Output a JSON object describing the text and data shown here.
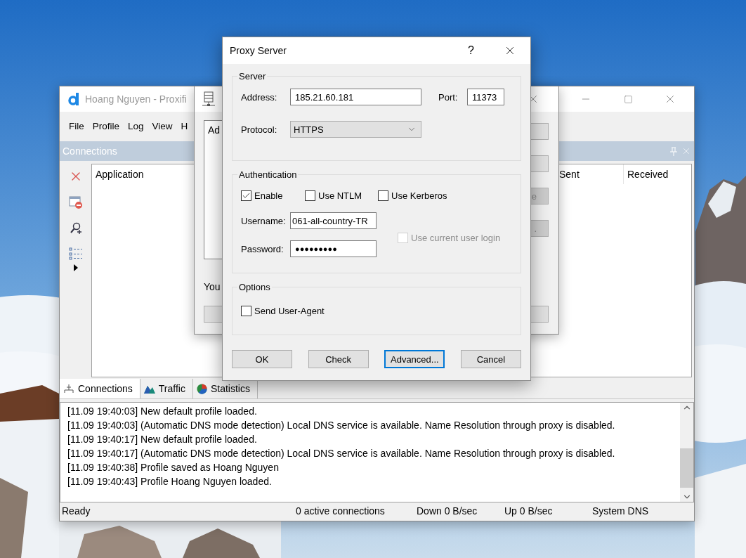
{
  "main_window": {
    "title": "Hoang Nguyen - Proxifi",
    "menu": [
      "File",
      "Profile",
      "Log",
      "View",
      "H"
    ],
    "panel": {
      "title": "Connections"
    },
    "table": {
      "columns": [
        "Application",
        "Sent",
        "Received"
      ]
    },
    "tabs": [
      {
        "label": "Connections",
        "selected": true
      },
      {
        "label": "Traffic",
        "selected": false
      },
      {
        "label": "Statistics",
        "selected": false
      }
    ],
    "log": [
      "[11.09 19:40:03] New default profile loaded.",
      "[11.09 19:40:03] (Automatic DNS mode detection) Local DNS service is available. Name Resolution through proxy is disabled.",
      "[11.09 19:40:17] New default profile loaded.",
      "[11.09 19:40:17] (Automatic DNS mode detection) Local DNS service is available. Name Resolution through proxy is disabled.",
      "[11.09 19:40:38] Profile saved as Hoang Nguyen",
      "[11.09 19:40:43] Profile Hoang Nguyen loaded."
    ],
    "status_bar": [
      "Ready",
      "0 active connections",
      "Down 0 B/sec",
      "Up 0 B/sec",
      "System DNS"
    ]
  },
  "proxy_list_dialog": {
    "list_header": "Ad",
    "note": "You",
    "buttons": [
      {
        "disabled": false
      },
      {
        "disabled": false
      },
      {
        "label": "e",
        "disabled": true
      },
      {
        "label": ".",
        "disabled": true
      }
    ]
  },
  "proxy_server_dialog": {
    "title": "Proxy Server",
    "help": "?",
    "server": {
      "title": "Server",
      "address_label": "Address:",
      "address": "185.21.60.181",
      "port_label": "Port:",
      "port": "11373",
      "protocol_label": "Protocol:",
      "protocol": "HTTPS"
    },
    "authentication": {
      "title": "Authentication",
      "options": [
        {
          "label": "Enable",
          "checked": true
        },
        {
          "label": "Use NTLM",
          "checked": false
        },
        {
          "label": "Use Kerberos",
          "checked": false
        }
      ],
      "username_label": "Username:",
      "username": "061-all-country-TR",
      "password_label": "Password:",
      "password": "●●●●●●●●●",
      "current_login": {
        "label": "Use current user login",
        "checked": false,
        "disabled": true
      }
    },
    "options": {
      "title": "Options",
      "send_user_agent": {
        "label": "Send User-Agent",
        "checked": false
      }
    },
    "buttons": [
      {
        "label": "OK",
        "focused": false
      },
      {
        "label": "Check",
        "focused": false
      },
      {
        "label": "Advanced...",
        "focused": true
      },
      {
        "label": "Cancel",
        "focused": false
      }
    ]
  }
}
